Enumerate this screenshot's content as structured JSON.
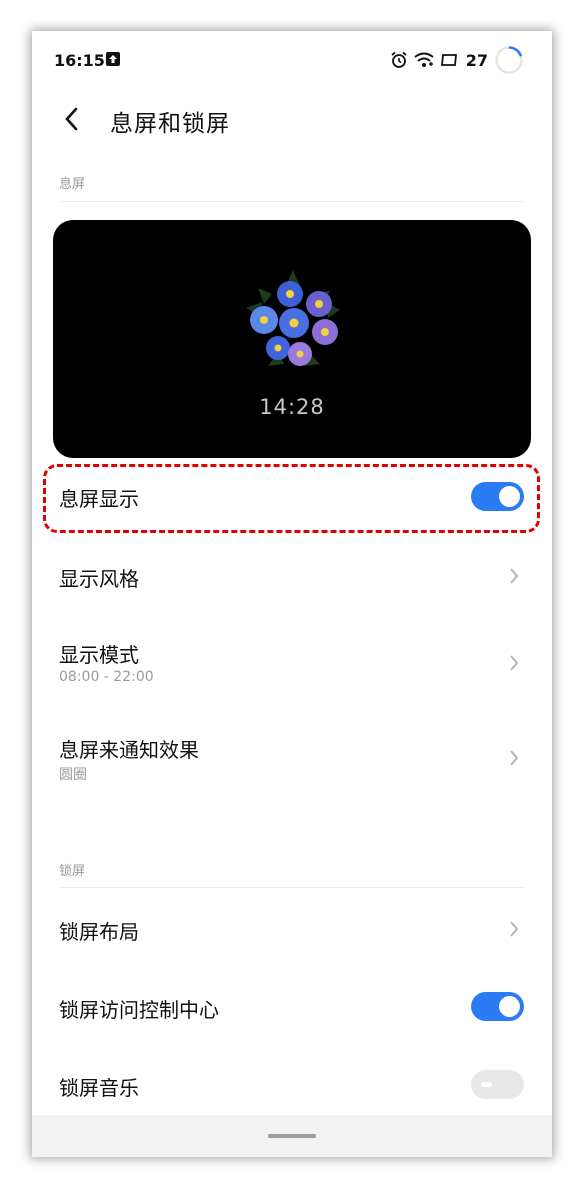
{
  "status_bar": {
    "time": "16:15",
    "battery_level": "27",
    "icons": [
      "upload-icon",
      "alarm-icon",
      "wifi-icon",
      "screen-icon",
      "battery-ring-icon"
    ]
  },
  "header": {
    "back_icon": "chevron-left-icon",
    "title": "息屏和锁屏"
  },
  "aod_section": {
    "label": "息屏",
    "preview": {
      "clock": "14:28",
      "image": "pansy-flowers"
    },
    "items": [
      {
        "title": "息屏显示",
        "control": "toggle",
        "state": "on"
      },
      {
        "title": "显示风格",
        "control": "chevron"
      },
      {
        "title": "显示模式",
        "subtitle": "08:00 - 22:00",
        "control": "chevron"
      },
      {
        "title": "息屏来通知效果",
        "subtitle": "圆圈",
        "control": "chevron"
      }
    ]
  },
  "lock_section": {
    "label": "锁屏",
    "items": [
      {
        "title": "锁屏布局",
        "control": "chevron"
      },
      {
        "title": "锁屏访问控制中心",
        "control": "toggle",
        "state": "on"
      },
      {
        "title": "锁屏音乐",
        "control": "toggle",
        "state": "off"
      }
    ]
  },
  "colors": {
    "accent": "#2b7cf4",
    "highlight_border": "#e00000",
    "toggle_off": "#e8e8e8",
    "secondary_text": "#9a9a9a"
  }
}
